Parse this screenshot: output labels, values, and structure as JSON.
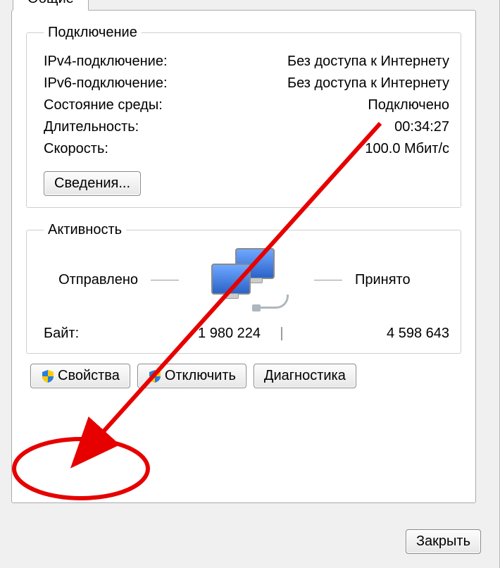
{
  "tab": {
    "general": "Общие"
  },
  "connection": {
    "legend": "Подключение",
    "ipv4_label": "IPv4-подключение:",
    "ipv4_value": "Без доступа к Интернету",
    "ipv6_label": "IPv6-подключение:",
    "ipv6_value": "Без доступа к Интернету",
    "media_label": "Состояние среды:",
    "media_value": "Подключено",
    "duration_label": "Длительность:",
    "duration_value": "00:34:27",
    "speed_label": "Скорость:",
    "speed_value": "100.0 Мбит/с",
    "details_btn": "Сведения..."
  },
  "activity": {
    "legend": "Активность",
    "sent_label": "Отправлено",
    "recv_label": "Принято",
    "bytes_label": "Байт:",
    "bytes_sent": "1 980 224",
    "bytes_recv": "4 598 643"
  },
  "buttons": {
    "properties": "Свойства",
    "disable": "Отключить",
    "diagnose": "Диагностика",
    "close": "Закрыть"
  },
  "icons": {
    "shield": "shield-icon",
    "network": "network-computers-icon"
  }
}
